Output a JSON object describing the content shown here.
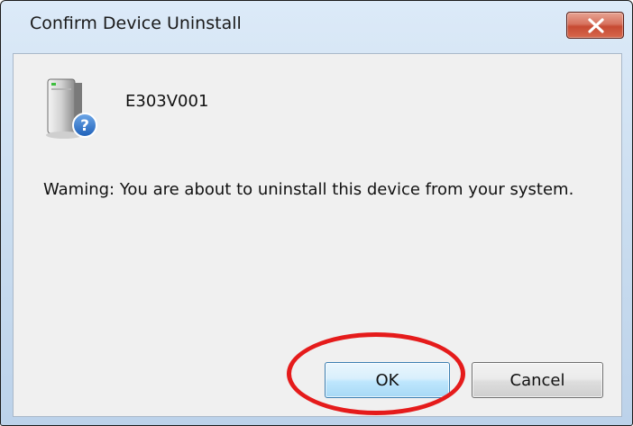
{
  "window": {
    "title": "Confirm Device Uninstall",
    "close_icon": "close-icon"
  },
  "device": {
    "icon": "device-question-icon",
    "name": "E303V001"
  },
  "message": {
    "warning": "Waming: You are about to uninstall this device from your system."
  },
  "buttons": {
    "ok_label": "OK",
    "cancel_label": "Cancel"
  },
  "annotation": {
    "highlight": "red-ellipse",
    "color": "#e51b1b"
  },
  "colors": {
    "close_red": "#c74a33",
    "ok_border": "#3c7fb1",
    "frame_blue": "#c9dcef"
  }
}
